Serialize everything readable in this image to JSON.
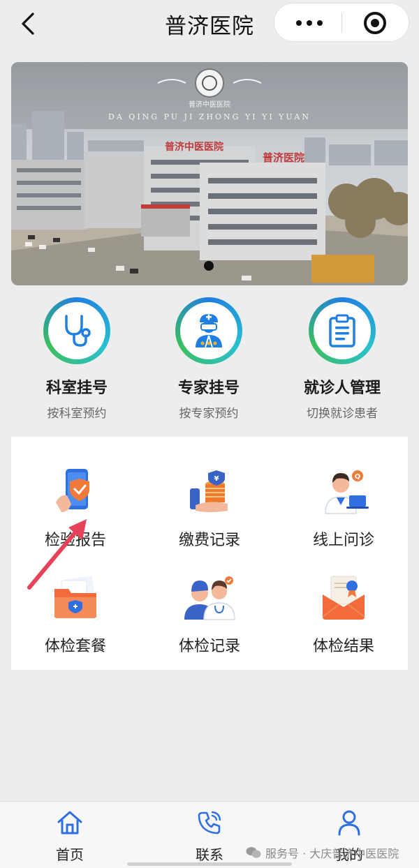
{
  "header": {
    "title": "普济医院"
  },
  "banner": {
    "logo_text": "普济中医医院",
    "pinyin": "DA  QING  PU  JI  ZHONG  YI  YI  YUAN",
    "sign_left": "普济中医医院",
    "sign_right": "普济医院"
  },
  "quick_entries": [
    {
      "title": "科室挂号",
      "subtitle": "按科室预约",
      "icon": "stethoscope-icon"
    },
    {
      "title": "专家挂号",
      "subtitle": "按专家预约",
      "icon": "doctor-icon"
    },
    {
      "title": "就诊人管理",
      "subtitle": "切换就诊患者",
      "icon": "clipboard-icon"
    }
  ],
  "services": [
    {
      "label": "检验报告",
      "icon": "phone-shield-icon"
    },
    {
      "label": "缴费记录",
      "icon": "coins-icon"
    },
    {
      "label": "线上问诊",
      "icon": "online-doctor-icon"
    },
    {
      "label": "体检套餐",
      "icon": "folder-medical-icon"
    },
    {
      "label": "体检记录",
      "icon": "doctors-team-icon"
    },
    {
      "label": "体检结果",
      "icon": "envelope-certificate-icon"
    }
  ],
  "tabbar": [
    {
      "label": "首页",
      "icon": "home-icon"
    },
    {
      "label": "联系",
      "icon": "phone-icon"
    },
    {
      "label": "我的",
      "icon": "user-icon"
    }
  ],
  "watermark": "服务号 · 大庆普济中医医院",
  "colors": {
    "accent": "#1f7fe0",
    "green": "#3cbf5e",
    "arrow": "#e8415a"
  }
}
